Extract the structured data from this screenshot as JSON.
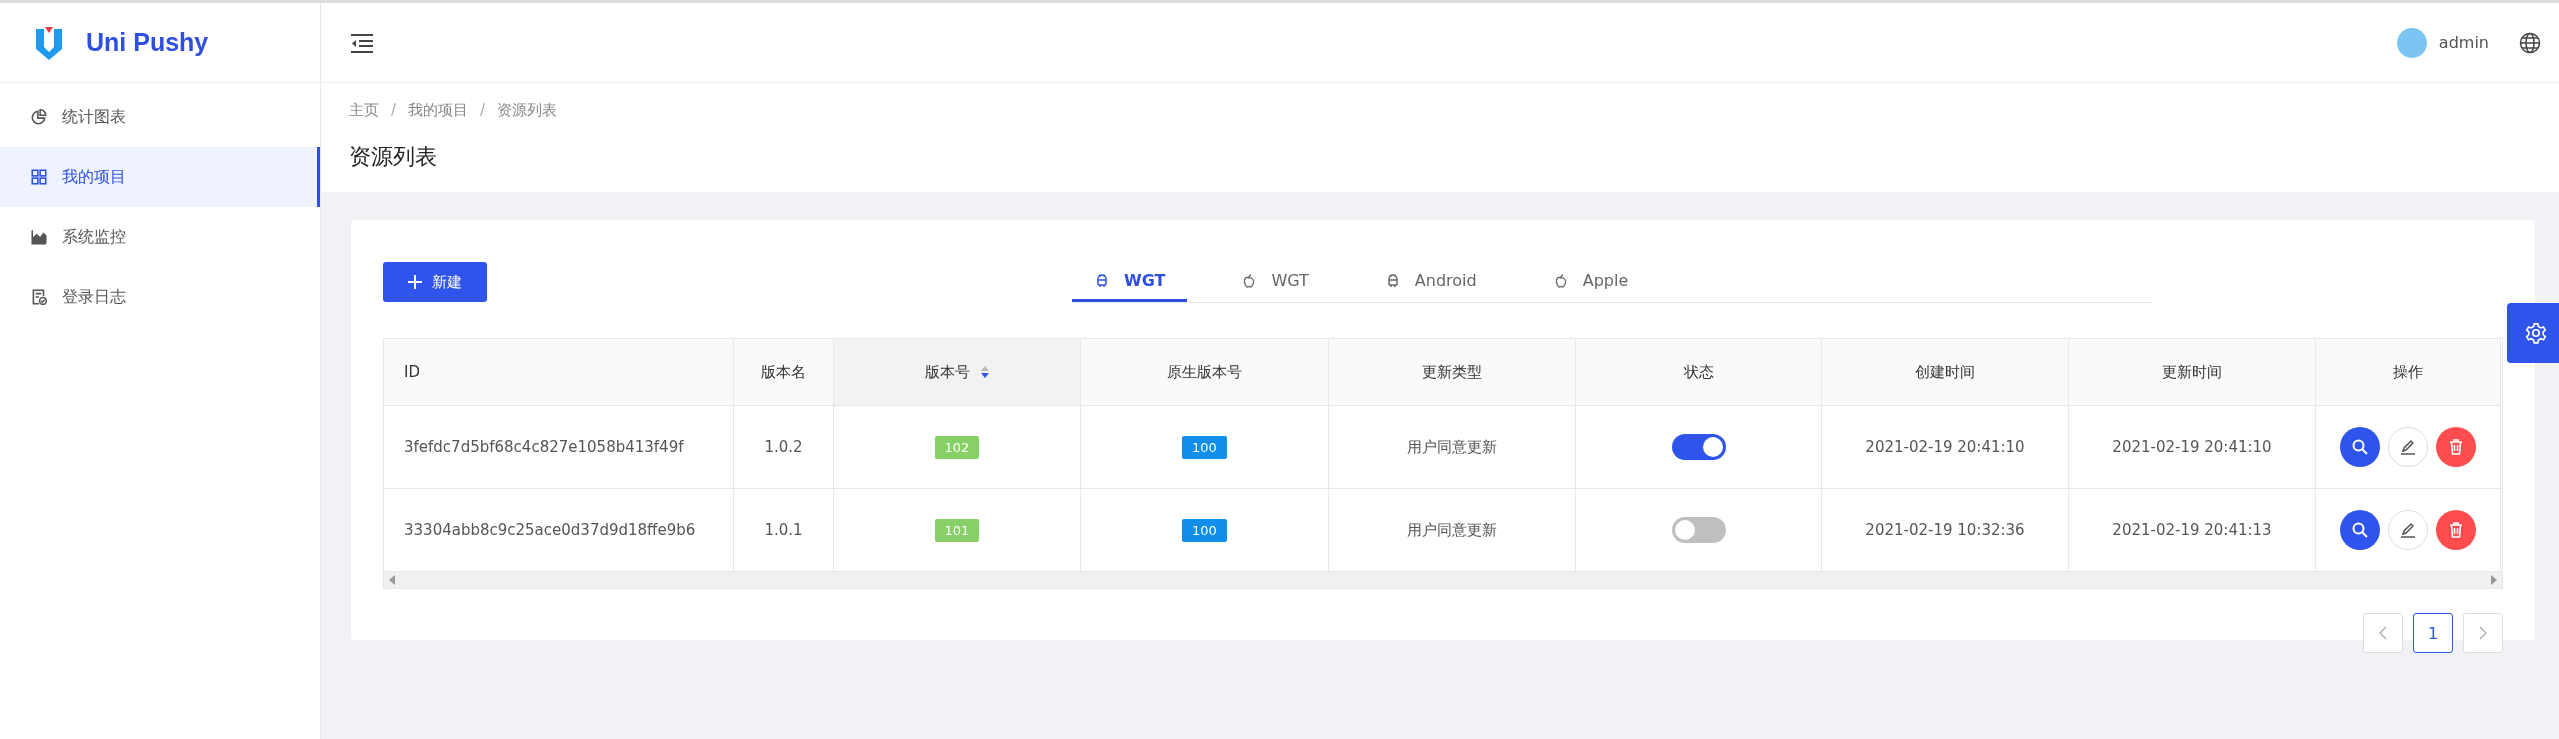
{
  "brand": {
    "name": "Uni Pushy"
  },
  "sidebar": {
    "items": [
      {
        "label": "统计图表",
        "selected": false
      },
      {
        "label": "我的项目",
        "selected": true
      },
      {
        "label": "系统监控",
        "selected": false
      },
      {
        "label": "登录日志",
        "selected": false
      }
    ]
  },
  "header": {
    "user": "admin"
  },
  "breadcrumb": {
    "separator": "/",
    "items": [
      "主页",
      "我的项目",
      "资源列表"
    ]
  },
  "page_title": "资源列表",
  "new_button": "新建",
  "tabs": [
    {
      "label": "WGT",
      "kind": "android",
      "selected": true
    },
    {
      "label": "WGT",
      "kind": "apple",
      "selected": false
    },
    {
      "label": "Android",
      "kind": "android",
      "selected": false
    },
    {
      "label": "Apple",
      "kind": "apple",
      "selected": false
    }
  ],
  "table": {
    "columns": [
      {
        "label": "ID",
        "sortable": false
      },
      {
        "label": "版本名",
        "sortable": false
      },
      {
        "label": "版本号",
        "sortable": true
      },
      {
        "label": "原生版本号",
        "sortable": false
      },
      {
        "label": "更新类型",
        "sortable": false
      },
      {
        "label": "状态",
        "sortable": false
      },
      {
        "label": "创建时间",
        "sortable": false
      },
      {
        "label": "更新时间",
        "sortable": false
      },
      {
        "label": "操作",
        "sortable": false
      }
    ],
    "rows": [
      {
        "id": "3fefdc7d5bf68c4c827e1058b413f49f",
        "name": "1.0.2",
        "version": "102",
        "native_version": "100",
        "update_type": "用户同意更新",
        "on": true,
        "created": "2021-02-19 20:41:10",
        "updated": "2021-02-19 20:41:10"
      },
      {
        "id": "33304abb8c9c25ace0d37d9d18ffe9b6",
        "name": "1.0.1",
        "version": "101",
        "native_version": "100",
        "update_type": "用户同意更新",
        "on": false,
        "created": "2021-02-19 10:32:36",
        "updated": "2021-02-19 20:41:13"
      }
    ]
  },
  "pagination": {
    "pages": [
      {
        "label": "1",
        "selected": true
      }
    ]
  }
}
